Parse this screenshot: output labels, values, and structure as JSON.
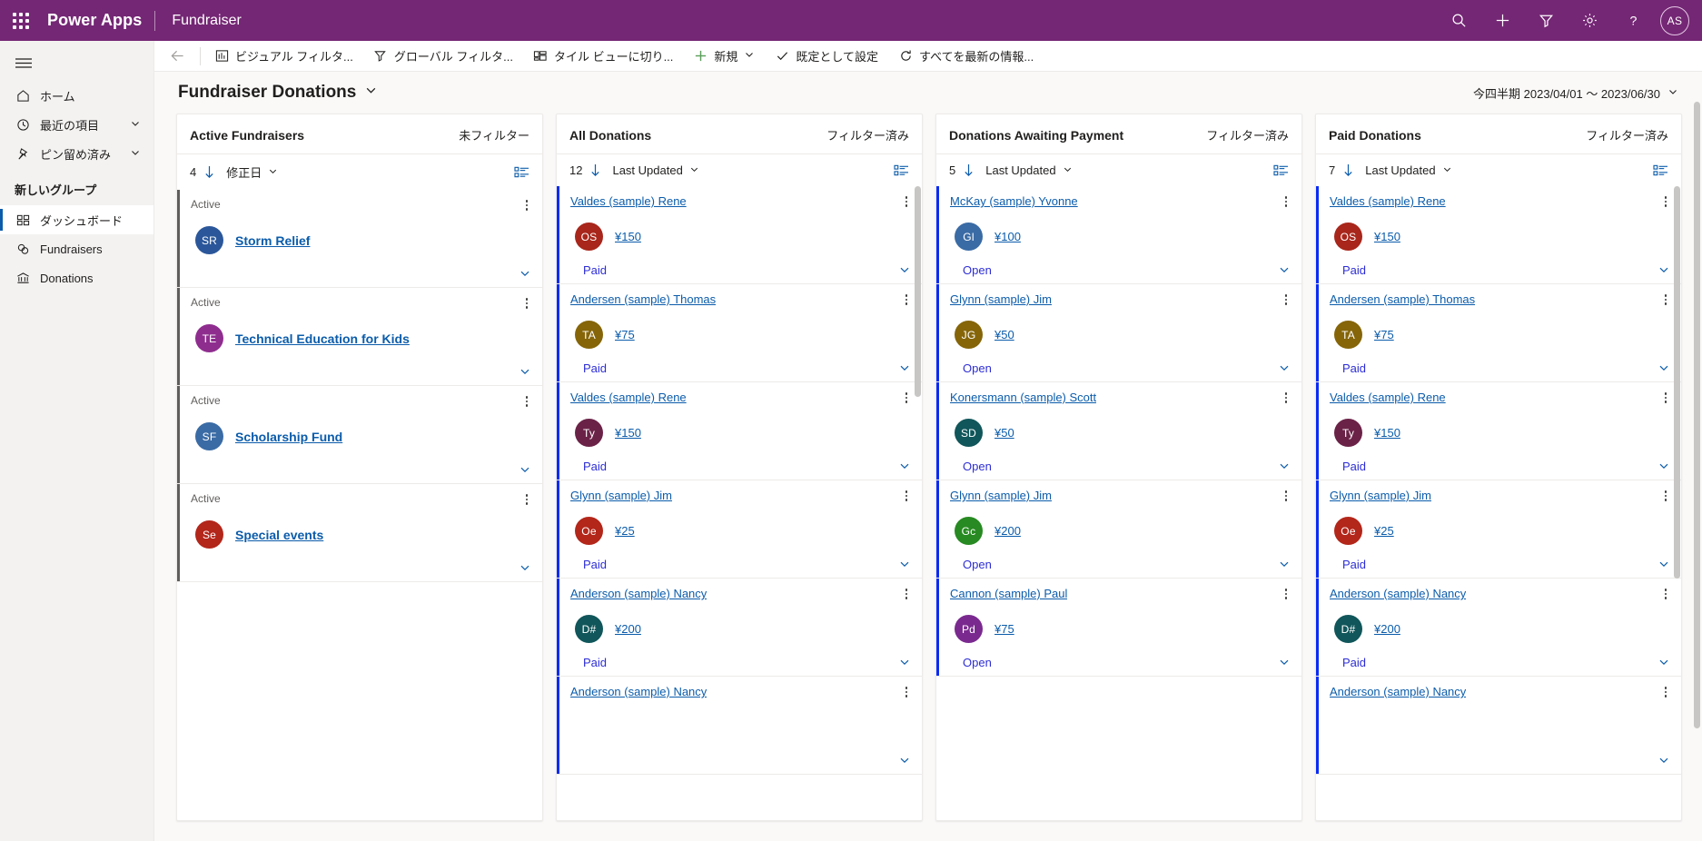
{
  "appbar": {
    "waffle_label": "waffle",
    "brand": "Power Apps",
    "app_name": "Fundraiser",
    "actions": [
      {
        "name": "search-icon",
        "label": "検索"
      },
      {
        "name": "new-icon",
        "label": "新規作成"
      },
      {
        "name": "filter-icon",
        "label": "フィルター"
      },
      {
        "name": "settings-icon",
        "label": "設定"
      },
      {
        "name": "help-icon",
        "label": "ヘルプ"
      }
    ],
    "avatar_initials": "AS",
    "brand_color": "#742774"
  },
  "sidebar": {
    "items": [
      {
        "label": "ホーム",
        "icon": "home-icon",
        "chevron": false,
        "selected": false
      },
      {
        "label": "最近の項目",
        "icon": "clock-icon",
        "chevron": true,
        "selected": false
      },
      {
        "label": "ピン留め済み",
        "icon": "pin-icon",
        "chevron": true,
        "selected": false
      }
    ],
    "group_title": "新しいグループ",
    "group_items": [
      {
        "label": "ダッシュボード",
        "icon": "dashboard-icon",
        "selected": true
      },
      {
        "label": "Fundraisers",
        "icon": "fundraiser-icon",
        "selected": false
      },
      {
        "label": "Donations",
        "icon": "bank-icon",
        "selected": false
      }
    ]
  },
  "commandbar": {
    "back_label": "戻る",
    "items": [
      {
        "label": "ビジュアル フィルタ...",
        "icon": "chart-icon"
      },
      {
        "label": "グローバル フィルタ...",
        "icon": "funnel-icon"
      },
      {
        "label": "タイル ビューに切り...",
        "icon": "tiles-icon"
      },
      {
        "label": "新規",
        "icon": "plus-icon",
        "chevron": true
      },
      {
        "label": "既定として設定",
        "icon": "check-icon"
      },
      {
        "label": "すべてを最新の情報...",
        "icon": "refresh-icon"
      }
    ]
  },
  "page": {
    "title": "Fundraiser Donations",
    "date_range": "今四半期 2023/04/01 〜 2023/06/30"
  },
  "streams": [
    {
      "title": "Active Fundraisers",
      "filter_state": "未フィルター",
      "count": "4",
      "sort_label": "修正日",
      "rail_color": "#605e5c",
      "type": "fundraiser",
      "cards": [
        {
          "state_label": "Active",
          "initials": "SR",
          "avatar_color": "#2b579a",
          "name": "Storm Relief"
        },
        {
          "state_label": "Active",
          "initials": "TE",
          "avatar_color": "#8f2d8f",
          "name": "Technical Education for Kids"
        },
        {
          "state_label": "Active",
          "initials": "SF",
          "avatar_color": "#3a6ba5",
          "name": "Scholarship Fund"
        },
        {
          "state_label": "Active",
          "initials": "Se",
          "avatar_color": "#b3261a",
          "name": "Special events"
        }
      ]
    },
    {
      "title": "All Donations",
      "filter_state": "フィルター済み",
      "count": "12",
      "sort_label": "Last Updated",
      "rail_color": "#0b2cf2",
      "type": "donation",
      "cards": [
        {
          "donor": "Valdes (sample) Rene",
          "initials": "OS",
          "avatar_color": "#a8261b",
          "amount": "¥150",
          "status": "Paid"
        },
        {
          "donor": "Andersen (sample) Thomas",
          "initials": "TA",
          "avatar_color": "#856508",
          "amount": "¥75",
          "status": "Paid"
        },
        {
          "donor": "Valdes (sample) Rene",
          "initials": "Ty",
          "avatar_color": "#6b2247",
          "amount": "¥150",
          "status": "Paid"
        },
        {
          "donor": "Glynn (sample) Jim",
          "initials": "Oe",
          "avatar_color": "#b3261a",
          "amount": "¥25",
          "status": "Paid"
        },
        {
          "donor": "Anderson (sample) Nancy",
          "initials": "D#",
          "avatar_color": "#10565a",
          "amount": "¥200",
          "status": "Paid"
        },
        {
          "donor": "Anderson (sample) Nancy",
          "initials": "",
          "avatar_color": "#10565a",
          "amount": "",
          "status": ""
        }
      ]
    },
    {
      "title": "Donations Awaiting Payment",
      "filter_state": "フィルター済み",
      "count": "5",
      "sort_label": "Last Updated",
      "rail_color": "#0b2cf2",
      "type": "donation",
      "cards": [
        {
          "donor": "McKay (sample) Yvonne",
          "initials": "Gl",
          "avatar_color": "#3a6ba5",
          "amount": "¥100",
          "status": "Open"
        },
        {
          "donor": "Glynn (sample) Jim",
          "initials": "JG",
          "avatar_color": "#856508",
          "amount": "¥50",
          "status": "Open"
        },
        {
          "donor": "Konersmann (sample) Scott",
          "initials": "SD",
          "avatar_color": "#10565a",
          "amount": "¥50",
          "status": "Open"
        },
        {
          "donor": "Glynn (sample) Jim",
          "initials": "Gc",
          "avatar_color": "#278a22",
          "amount": "¥200",
          "status": "Open"
        },
        {
          "donor": "Cannon (sample) Paul",
          "initials": "Pd",
          "avatar_color": "#7a2a8f",
          "amount": "¥75",
          "status": "Open"
        }
      ]
    },
    {
      "title": "Paid Donations",
      "filter_state": "フィルター済み",
      "count": "7",
      "sort_label": "Last Updated",
      "rail_color": "#0b2cf2",
      "type": "donation",
      "cards": [
        {
          "donor": "Valdes (sample) Rene",
          "initials": "OS",
          "avatar_color": "#a8261b",
          "amount": "¥150",
          "status": "Paid"
        },
        {
          "donor": "Andersen (sample) Thomas",
          "initials": "TA",
          "avatar_color": "#856508",
          "amount": "¥75",
          "status": "Paid"
        },
        {
          "donor": "Valdes (sample) Rene",
          "initials": "Ty",
          "avatar_color": "#6b2247",
          "amount": "¥150",
          "status": "Paid"
        },
        {
          "donor": "Glynn (sample) Jim",
          "initials": "Oe",
          "avatar_color": "#b3261a",
          "amount": "¥25",
          "status": "Paid"
        },
        {
          "donor": "Anderson (sample) Nancy",
          "initials": "D#",
          "avatar_color": "#10565a",
          "amount": "¥200",
          "status": "Paid"
        },
        {
          "donor": "Anderson (sample) Nancy",
          "initials": "",
          "avatar_color": "#10565a",
          "amount": "",
          "status": ""
        }
      ]
    }
  ]
}
